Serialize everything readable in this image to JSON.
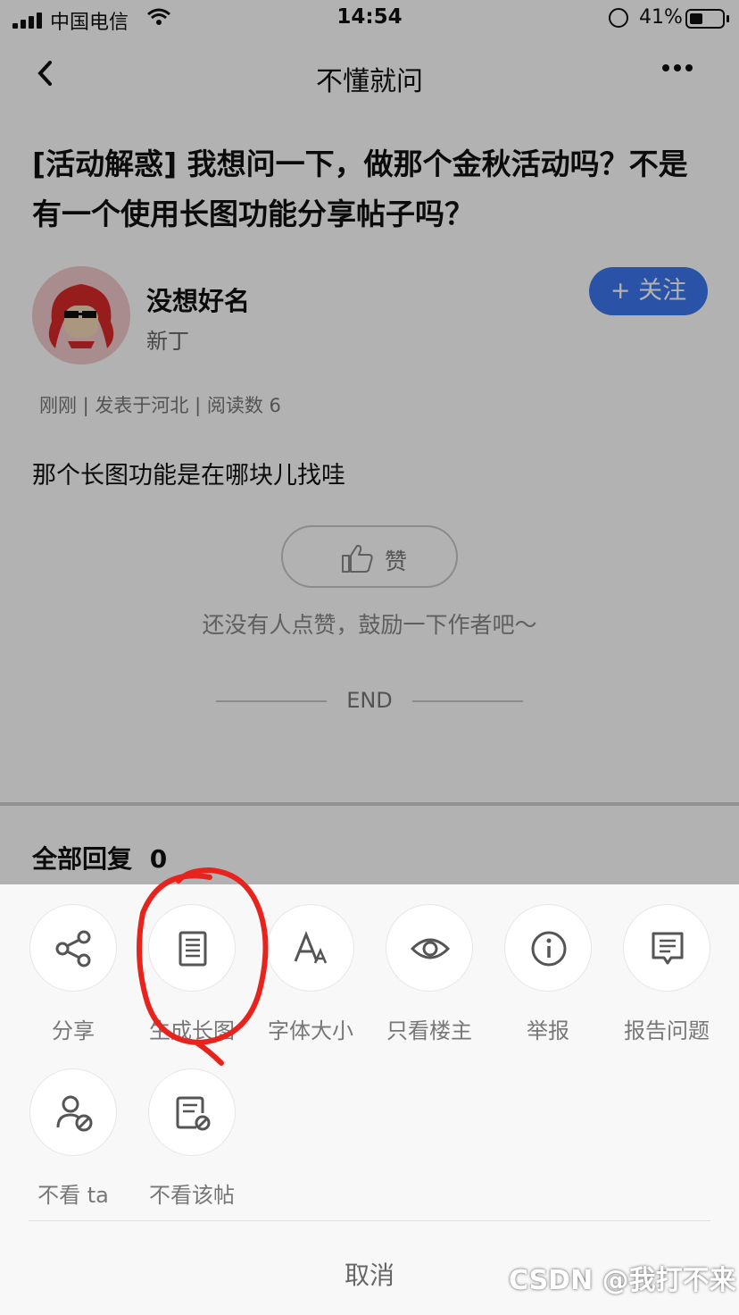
{
  "status_bar": {
    "carrier": "中国电信",
    "time": "14:54",
    "battery_percent": "41%"
  },
  "nav": {
    "title": "不懂就问"
  },
  "post": {
    "title": "[活动解惑] 我想问一下，做那个金秋活动吗？不是有一个使用长图功能分享帖子吗？",
    "author": {
      "name": "没想好名",
      "level": "新丁",
      "follow_label": "+ 关注"
    },
    "meta": "刚刚 | 发表于河北 | 阅读数 6",
    "body": "那个长图功能是在哪块儿找哇",
    "like_label": "赞",
    "like_hint": "还没有人点赞，鼓励一下作者吧～",
    "end_label": "END"
  },
  "replies": {
    "label": "全部回复",
    "count": "0"
  },
  "action_sheet": {
    "actions": [
      {
        "label": "分享",
        "icon": "share-icon"
      },
      {
        "label": "生成长图",
        "icon": "long-image-icon"
      },
      {
        "label": "字体大小",
        "icon": "font-size-icon"
      },
      {
        "label": "只看楼主",
        "icon": "eye-icon"
      },
      {
        "label": "举报",
        "icon": "info-icon"
      },
      {
        "label": "报告问题",
        "icon": "report-icon"
      },
      {
        "label": "不看 ta",
        "icon": "block-user-icon"
      },
      {
        "label": "不看该帖",
        "icon": "block-post-icon"
      }
    ],
    "cancel_label": "取消"
  },
  "watermark": "CSDN @我打不来",
  "colors": {
    "accent": "#3d78f0",
    "annotation": "#e8231e"
  }
}
